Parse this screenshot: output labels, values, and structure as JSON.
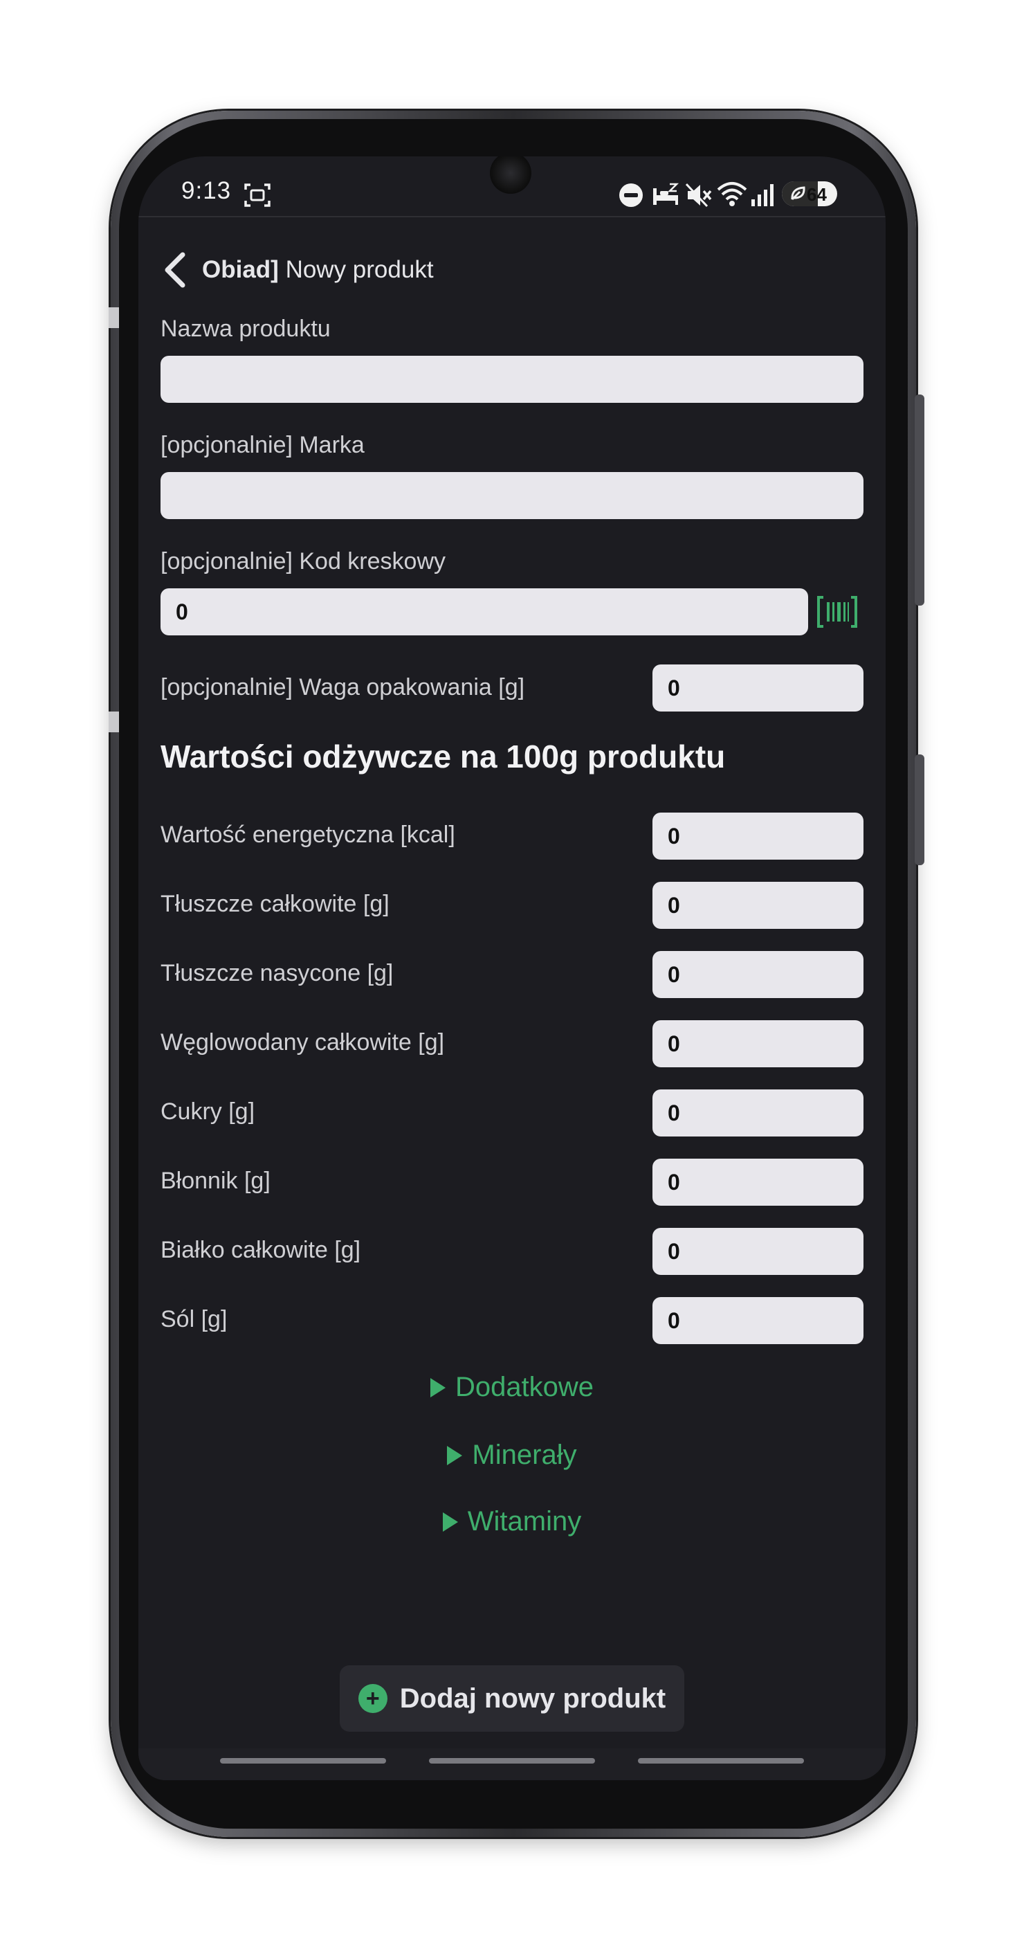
{
  "status_bar": {
    "time": "9:13",
    "battery": "64",
    "icons": [
      "screenshot-icon",
      "dnd-icon",
      "sleep-icon",
      "mute-icon",
      "wifi-icon",
      "signal-icon",
      "battery-saver-icon"
    ]
  },
  "header": {
    "meal": "Obiad]",
    "title": "Nowy produkt"
  },
  "form": {
    "name_label": "Nazwa produktu",
    "name_value": "",
    "brand_label": "[opcjonalnie] Marka",
    "brand_value": "",
    "barcode_label": "[opcjonalnie] Kod kreskowy",
    "barcode_value": "0",
    "package_label": "[opcjonalnie] Waga opakowania [g]",
    "package_value": "0"
  },
  "nutrition": {
    "heading": "Wartości odżywcze na 100g produktu",
    "rows": [
      {
        "label": "Wartość energetyczna [kcal]",
        "value": "0"
      },
      {
        "label": "Tłuszcze całkowite [g]",
        "value": "0"
      },
      {
        "label": "Tłuszcze nasycone [g]",
        "value": "0"
      },
      {
        "label": "Węglowodany całkowite [g]",
        "value": "0"
      },
      {
        "label": "Cukry [g]",
        "value": "0"
      },
      {
        "label": "Błonnik [g]",
        "value": "0"
      },
      {
        "label": "Białko całkowite [g]",
        "value": "0"
      },
      {
        "label": "Sól [g]",
        "value": "0"
      }
    ]
  },
  "expanders": {
    "extra": "Dodatkowe",
    "minerals": "Minerały",
    "vitamins": "Witaminy"
  },
  "add_button": {
    "label": "Dodaj nowy produkt"
  },
  "colors": {
    "background": "#1c1c21",
    "accent": "#3fae6c",
    "input": "#e8e7ec"
  }
}
